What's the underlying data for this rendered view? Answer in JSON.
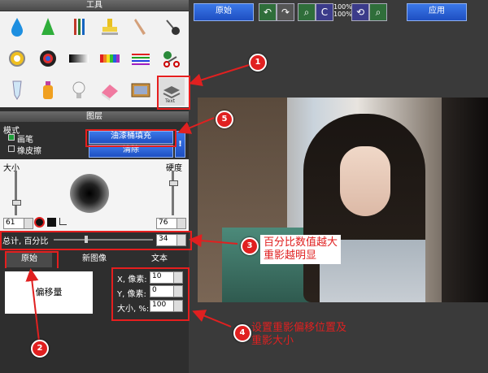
{
  "tools_panel": {
    "title": "工具"
  },
  "layers_panel": {
    "title": "图层",
    "mode_label": "模式",
    "mode_options": [
      {
        "label": "画笔",
        "selected": true
      },
      {
        "label": "橡皮擦",
        "selected": false
      }
    ],
    "fill_button": "油漆桶填充",
    "clear_button": "清除",
    "info_glyph": "!",
    "size_label": "大小",
    "hardness_label": "硬度",
    "size_value": "61",
    "hardness_value": "76",
    "opacity_label": "总计, 百分比",
    "opacity_value": "34"
  },
  "tabs": [
    {
      "label": "原始",
      "active": true
    },
    {
      "label": "新图像",
      "active": false
    },
    {
      "label": "文本",
      "active": false
    }
  ],
  "offset": {
    "preview_label": "偏移量",
    "x_label": "X, 像素:",
    "x_value": "10",
    "y_label": "Y, 像素:",
    "y_value": "0",
    "size_label": "大小, %:",
    "size_value": "100"
  },
  "toolbar": {
    "original_button": "原始",
    "zoom_top": "100%",
    "zoom_bottom": "100%",
    "apply_button": "应用"
  },
  "annotations": {
    "badge1": "1",
    "badge2": "2",
    "badge3": "3",
    "badge4": "4",
    "badge5": "5",
    "note3_line1": "百分比数值越大",
    "note3_line2": "重影越明显",
    "note4_line1": "设置重影偏移位置及",
    "note4_line2": "重影大小"
  },
  "tool_icons": [
    "water-drop-icon",
    "cone-icon",
    "pencils-icon",
    "stamp-icon",
    "finger-smudge-icon",
    "pin-icon",
    "lasso-icon",
    "color-wheel-icon",
    "gradient-icon",
    "color-palette-icon",
    "color-lines-icon",
    "clone-scissors-icon",
    "tube-icon",
    "bottle-icon",
    "bulb-icon",
    "eraser-icon",
    "picture-brush-icon",
    "text-layer-icon"
  ],
  "colors": {
    "accent_blue": "#1e4fc2",
    "annotation_red": "#e02020"
  }
}
